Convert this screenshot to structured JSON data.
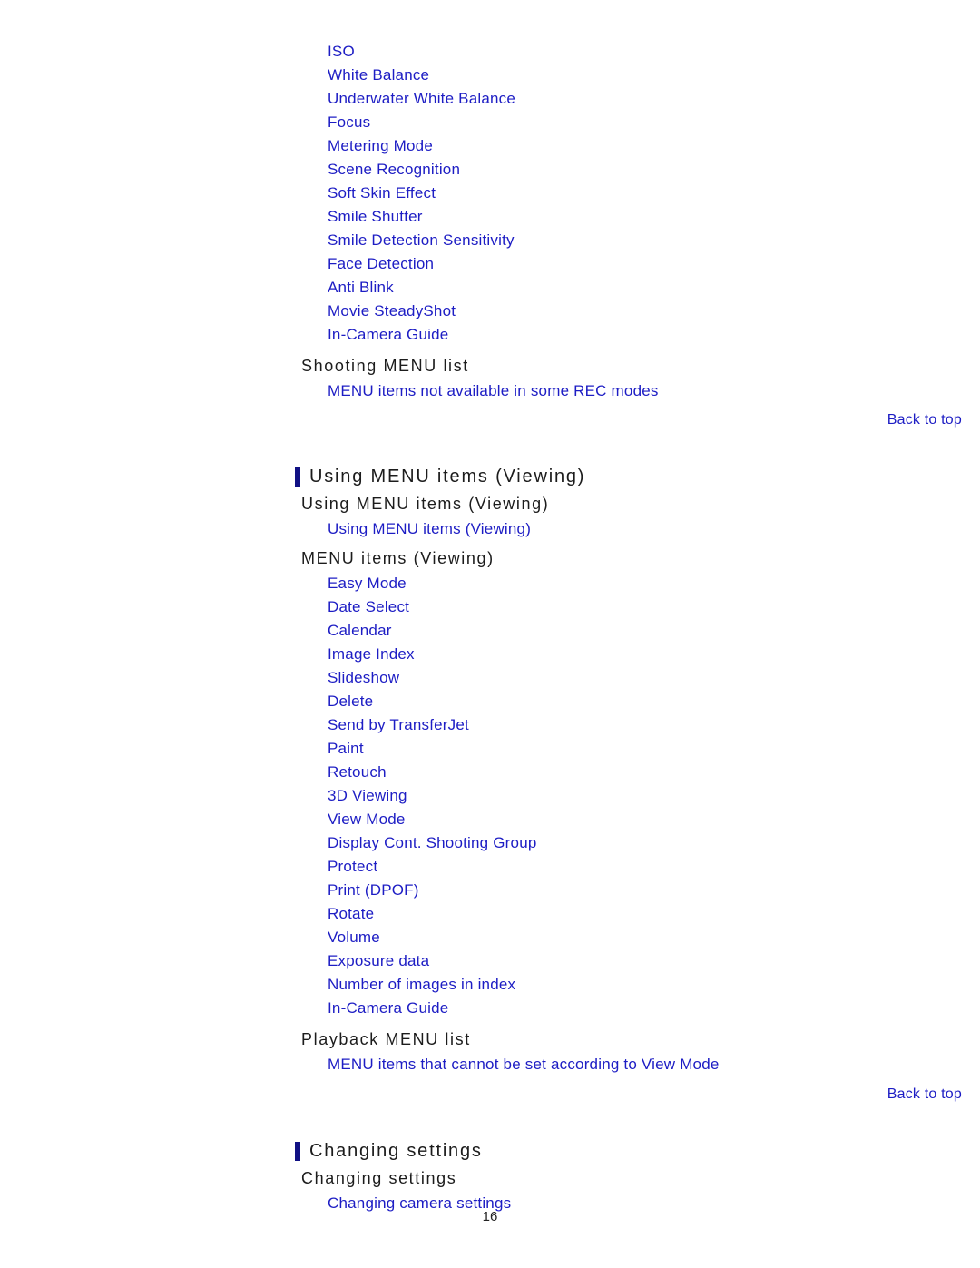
{
  "document": {
    "page_number": "16",
    "link_color": "#1d1dc4",
    "heading_color": "#1c1c1c",
    "accent_bar_color": "#111184",
    "background_color": "#ffffff"
  },
  "back_to_top_label": "Back to top",
  "sections": [
    {
      "shooting_menu_links": [
        "ISO",
        "White Balance",
        "Underwater White Balance",
        "Focus",
        "Metering Mode",
        "Scene Recognition",
        "Soft Skin Effect",
        "Smile Shutter",
        "Smile Detection Sensitivity",
        "Face Detection",
        "Anti Blink",
        "Movie SteadyShot",
        "In-Camera Guide"
      ],
      "shooting_menu_list_heading": "Shooting MENU list",
      "shooting_menu_list_link": "MENU items not available in some REC modes"
    }
  ],
  "viewing_section": {
    "section_heading": "Using MENU items (Viewing)",
    "subheading": "Using MENU items (Viewing)",
    "intro_link": "Using MENU items (Viewing)",
    "menu_items_heading": "MENU items (Viewing)",
    "menu_items_links": [
      "Easy Mode",
      "Date Select",
      "Calendar",
      "Image Index",
      "Slideshow",
      "Delete",
      "Send by TransferJet",
      "Paint",
      "Retouch",
      "3D Viewing",
      "View Mode",
      "Display Cont. Shooting Group",
      "Protect",
      "Print (DPOF)",
      "Rotate",
      "Volume",
      "Exposure data",
      "Number of images in index",
      "In-Camera Guide"
    ],
    "playback_menu_list_heading": "Playback MENU list",
    "playback_menu_list_link": "MENU items that cannot be set according to View Mode"
  },
  "settings_section": {
    "section_heading": "Changing settings",
    "subheading": "Changing settings",
    "link": "Changing camera settings"
  }
}
